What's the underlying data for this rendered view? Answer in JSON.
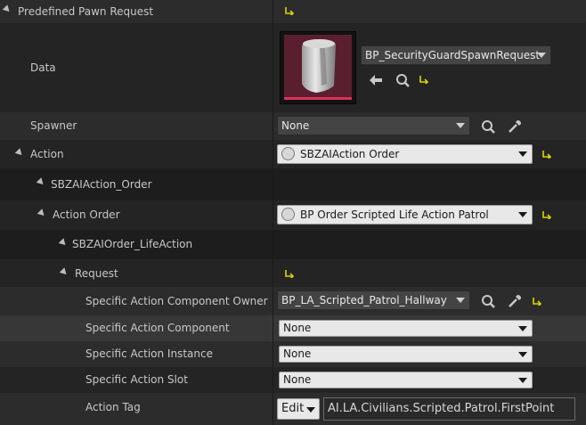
{
  "colors": {
    "panel_bg": "#242424",
    "reset_arrow": "#d7d700",
    "asset_thumb_bg": "#5a1f2e",
    "asset_thumb_bar": "#d8335a"
  },
  "header": {
    "title": "Predefined Pawn Request"
  },
  "data": {
    "label": "Data",
    "asset_name": "BP_SecurityGuardSpawnRequest"
  },
  "spawner": {
    "label": "Spawner",
    "value": "None"
  },
  "action": {
    "label": "Action",
    "value": "SBZAIAction Order"
  },
  "action_order_category": {
    "label": "SBZAIAction_Order"
  },
  "action_order": {
    "label": "Action Order",
    "value": "BP Order Scripted Life Action Patrol"
  },
  "life_action_category": {
    "label": "SBZAIOrder_LifeAction"
  },
  "request": {
    "label": "Request"
  },
  "specific_action_component_owner": {
    "label": "Specific Action Component Owner",
    "value": "BP_LA_Scripted_Patrol_Hallway"
  },
  "specific_action_component": {
    "label": "Specific Action Component",
    "value": "None"
  },
  "specific_action_instance": {
    "label": "Specific Action Instance",
    "value": "None"
  },
  "specific_action_slot": {
    "label": "Specific Action Slot",
    "value": "None"
  },
  "action_tag": {
    "label": "Action Tag",
    "edit_label": "Edit",
    "value": "AI.LA.Civilians.Scripted.Patrol.FirstPoint"
  }
}
